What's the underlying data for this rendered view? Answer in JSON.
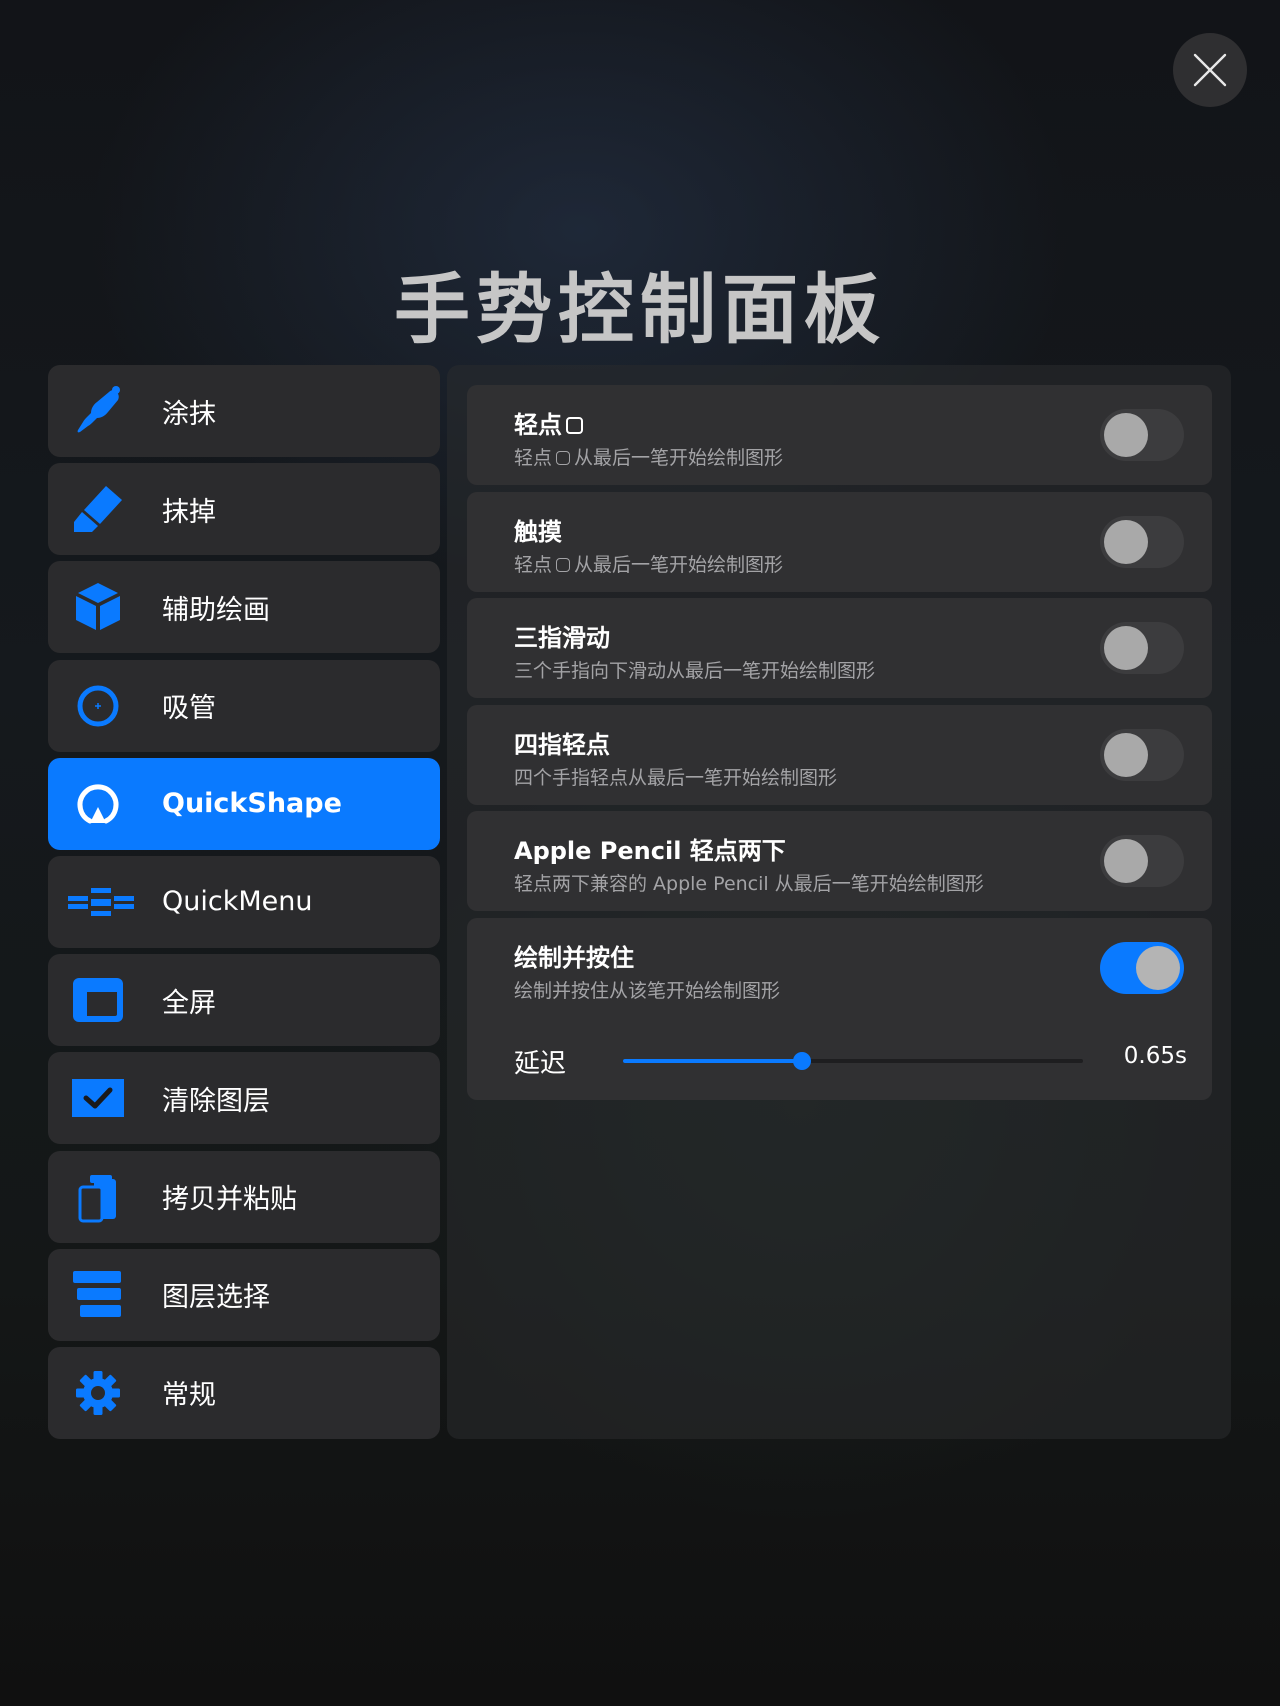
{
  "page": {
    "title": "手势控制面板"
  },
  "colors": {
    "accent": "#0a7aff",
    "row_background": "#303032",
    "sidebar_background": "#2b2b2d"
  },
  "sidebar": {
    "items": [
      {
        "label": "涂抹",
        "icon": "smudge-brush-icon",
        "active": false
      },
      {
        "label": "抹掉",
        "icon": "eraser-icon",
        "active": false
      },
      {
        "label": "辅助绘画",
        "icon": "cube-icon",
        "active": false
      },
      {
        "label": "吸管",
        "icon": "eyedropper-icon",
        "active": false
      },
      {
        "label": "QuickShape",
        "icon": "quickshape-icon",
        "active": true
      },
      {
        "label": "QuickMenu",
        "icon": "quickmenu-icon",
        "active": false
      },
      {
        "label": "全屏",
        "icon": "fullscreen-icon",
        "active": false
      },
      {
        "label": "清除图层",
        "icon": "clear-layer-icon",
        "active": false
      },
      {
        "label": "拷贝并粘贴",
        "icon": "clipboard-icon",
        "active": false
      },
      {
        "label": "图层选择",
        "icon": "layers-icon",
        "active": false
      },
      {
        "label": "常规",
        "icon": "gear-icon",
        "active": false
      }
    ]
  },
  "settings": [
    {
      "title_prefix": "轻点",
      "title_suffix": "",
      "title_has_glyph": true,
      "desc_prefix": "轻点",
      "desc_suffix": "从最后一笔开始绘制图形",
      "desc_has_glyph": true,
      "enabled": false
    },
    {
      "title_prefix": "触摸",
      "title_suffix": "",
      "title_has_glyph": false,
      "desc_prefix": "轻点",
      "desc_suffix": "从最后一笔开始绘制图形",
      "desc_has_glyph": true,
      "enabled": false
    },
    {
      "title_prefix": "三指滑动",
      "title_suffix": "",
      "title_has_glyph": false,
      "desc_prefix": "三个手指向下滑动从最后一笔开始绘制图形",
      "desc_suffix": "",
      "desc_has_glyph": false,
      "enabled": false
    },
    {
      "title_prefix": "四指轻点",
      "title_suffix": "",
      "title_has_glyph": false,
      "desc_prefix": "四个手指轻点从最后一笔开始绘制图形",
      "desc_suffix": "",
      "desc_has_glyph": false,
      "enabled": false
    },
    {
      "title_prefix": "Apple Pencil 轻点两下",
      "title_suffix": "",
      "title_has_glyph": false,
      "desc_prefix": "轻点两下兼容的 Apple Pencil 从最后一笔开始绘制图形",
      "desc_suffix": "",
      "desc_has_glyph": false,
      "enabled": false
    },
    {
      "title_prefix": "绘制并按住",
      "title_suffix": "",
      "title_has_glyph": false,
      "desc_prefix": "绘制并按住从该笔开始绘制图形",
      "desc_suffix": "",
      "desc_has_glyph": false,
      "enabled": true
    }
  ],
  "delay": {
    "label": "延迟",
    "value_text": "0.65s",
    "fraction": 0.39
  }
}
